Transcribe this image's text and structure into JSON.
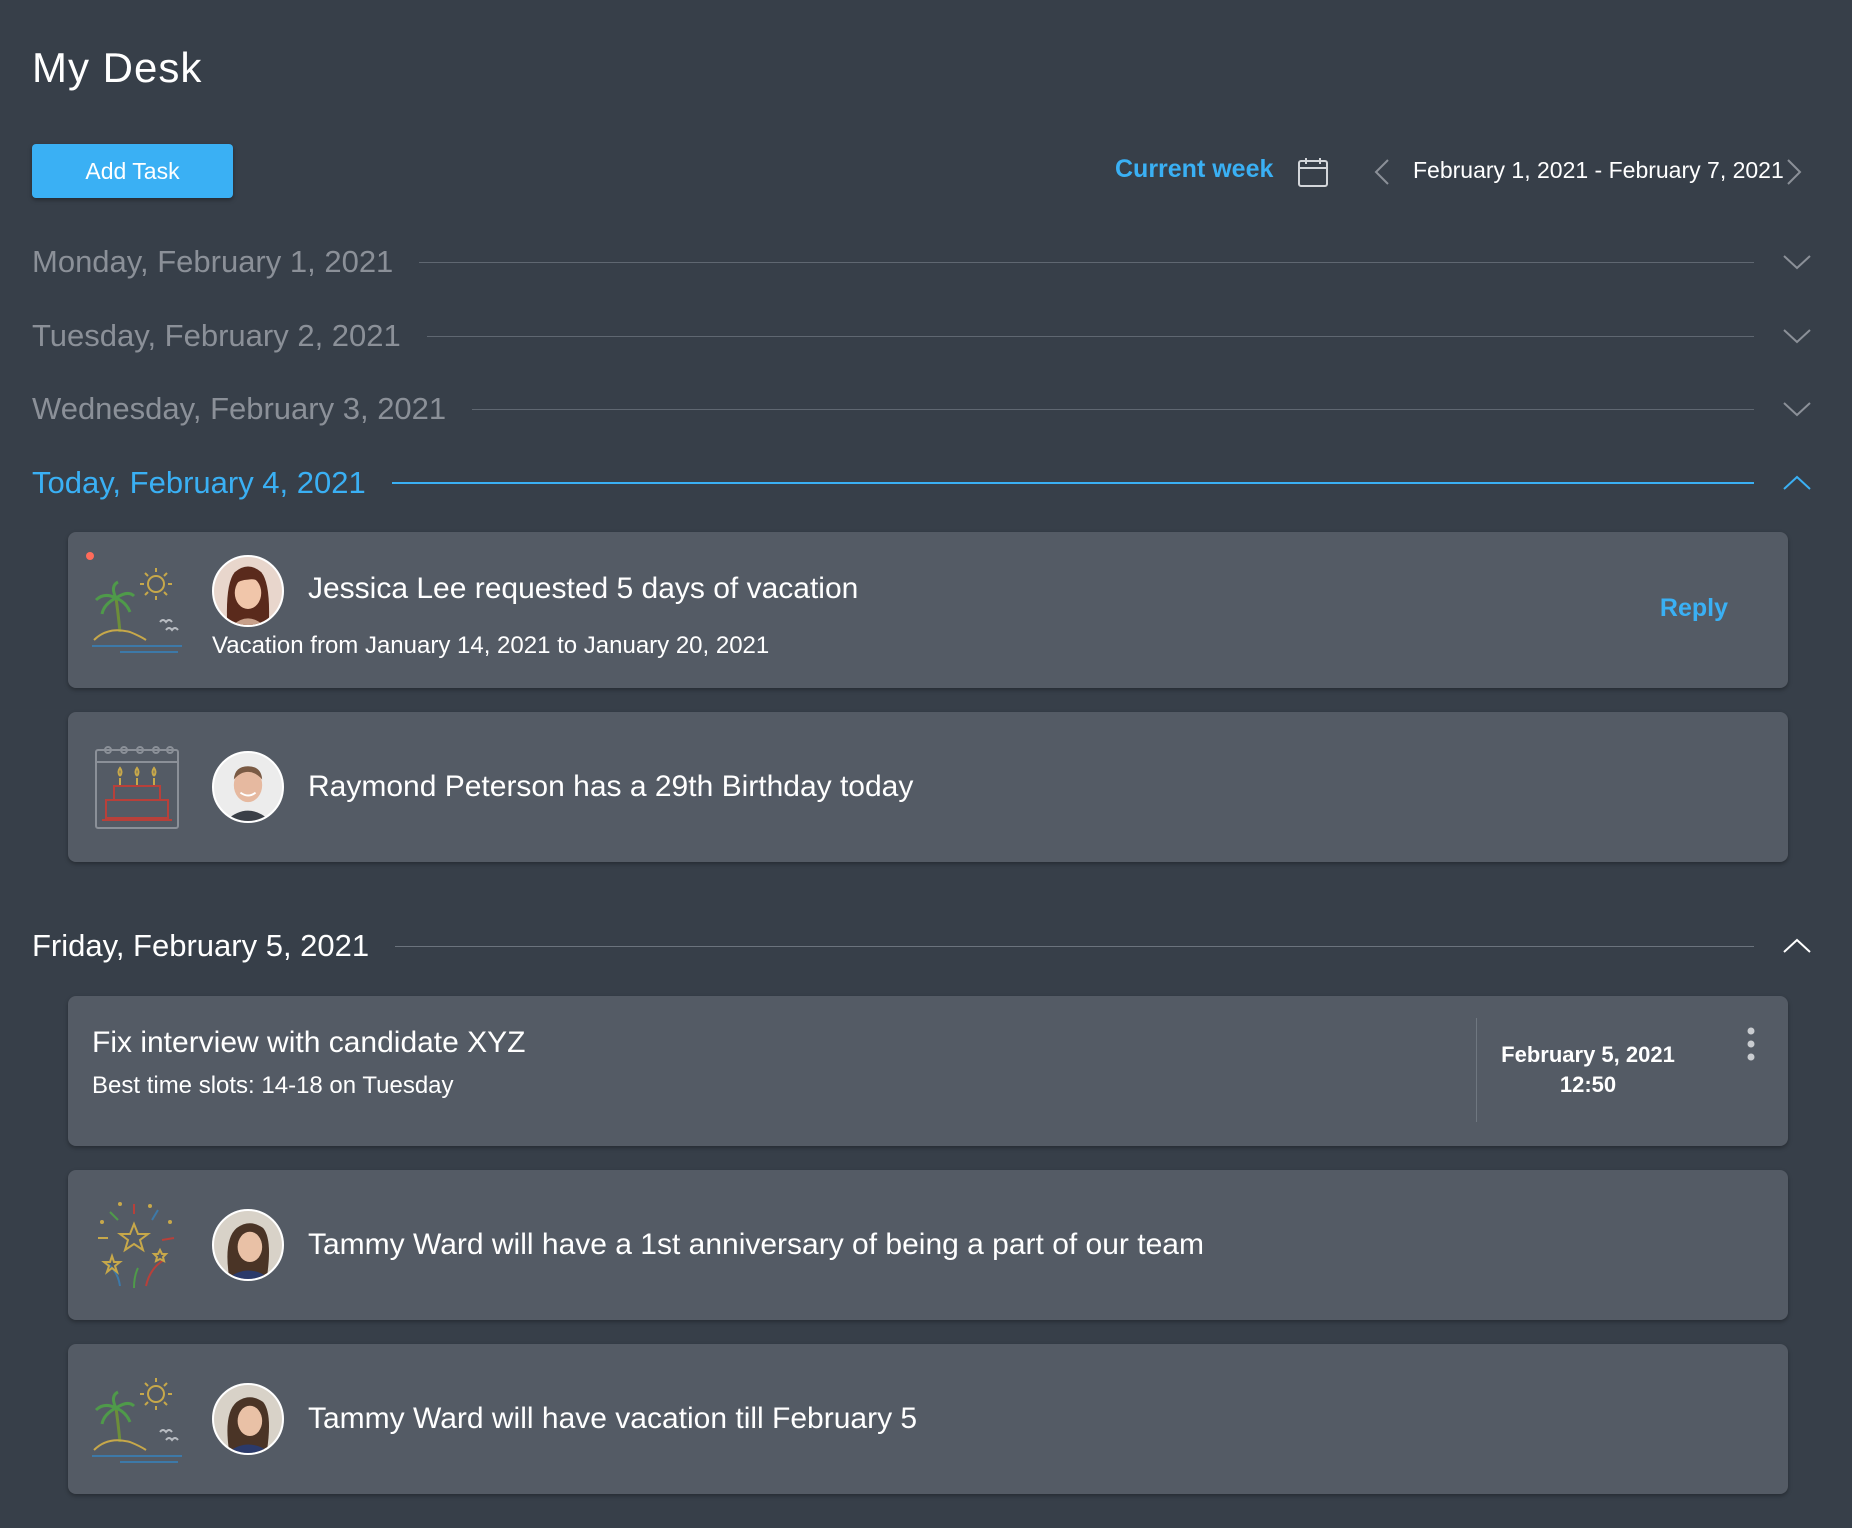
{
  "page": {
    "title": "My Desk"
  },
  "toolbar": {
    "add_task_label": "Add Task",
    "current_week_label": "Current week",
    "date_range": "February 1, 2021 - February 7, 2021"
  },
  "days": [
    {
      "label": "Monday, February 1, 2021",
      "expanded": false
    },
    {
      "label": "Tuesday, February 2, 2021",
      "expanded": false
    },
    {
      "label": "Wednesday, February 3, 2021",
      "expanded": false
    },
    {
      "label": "Today, February 4, 2021",
      "expanded": true
    },
    {
      "label": "Friday, February 5, 2021",
      "expanded": true
    }
  ],
  "today_items": [
    {
      "icon": "beach-vacation-icon",
      "title": "Jessica Lee requested 5 days of vacation",
      "subtitle": "Vacation from January 14, 2021 to January 20, 2021",
      "action": "Reply",
      "unread": true
    },
    {
      "icon": "birthday-cake-calendar-icon",
      "title": "Raymond Peterson has a 29th Birthday today"
    }
  ],
  "friday_items": {
    "task": {
      "title": "Fix interview with candidate XYZ",
      "subtitle": "Best time slots: 14-18 on Tuesday",
      "due_date": "February 5, 2021",
      "due_time": "12:50"
    },
    "events": [
      {
        "icon": "fireworks-anniversary-icon",
        "title": "Tammy Ward will have a 1st anniversary of being a part of our team"
      },
      {
        "icon": "beach-vacation-icon",
        "title": "Tammy Ward will have vacation till February 5"
      }
    ]
  },
  "colors": {
    "background": "#373f49",
    "card": "#545b65",
    "accent": "#3ab0f4",
    "muted_text": "#8b9098",
    "unread_dot": "#ff6b5a"
  }
}
